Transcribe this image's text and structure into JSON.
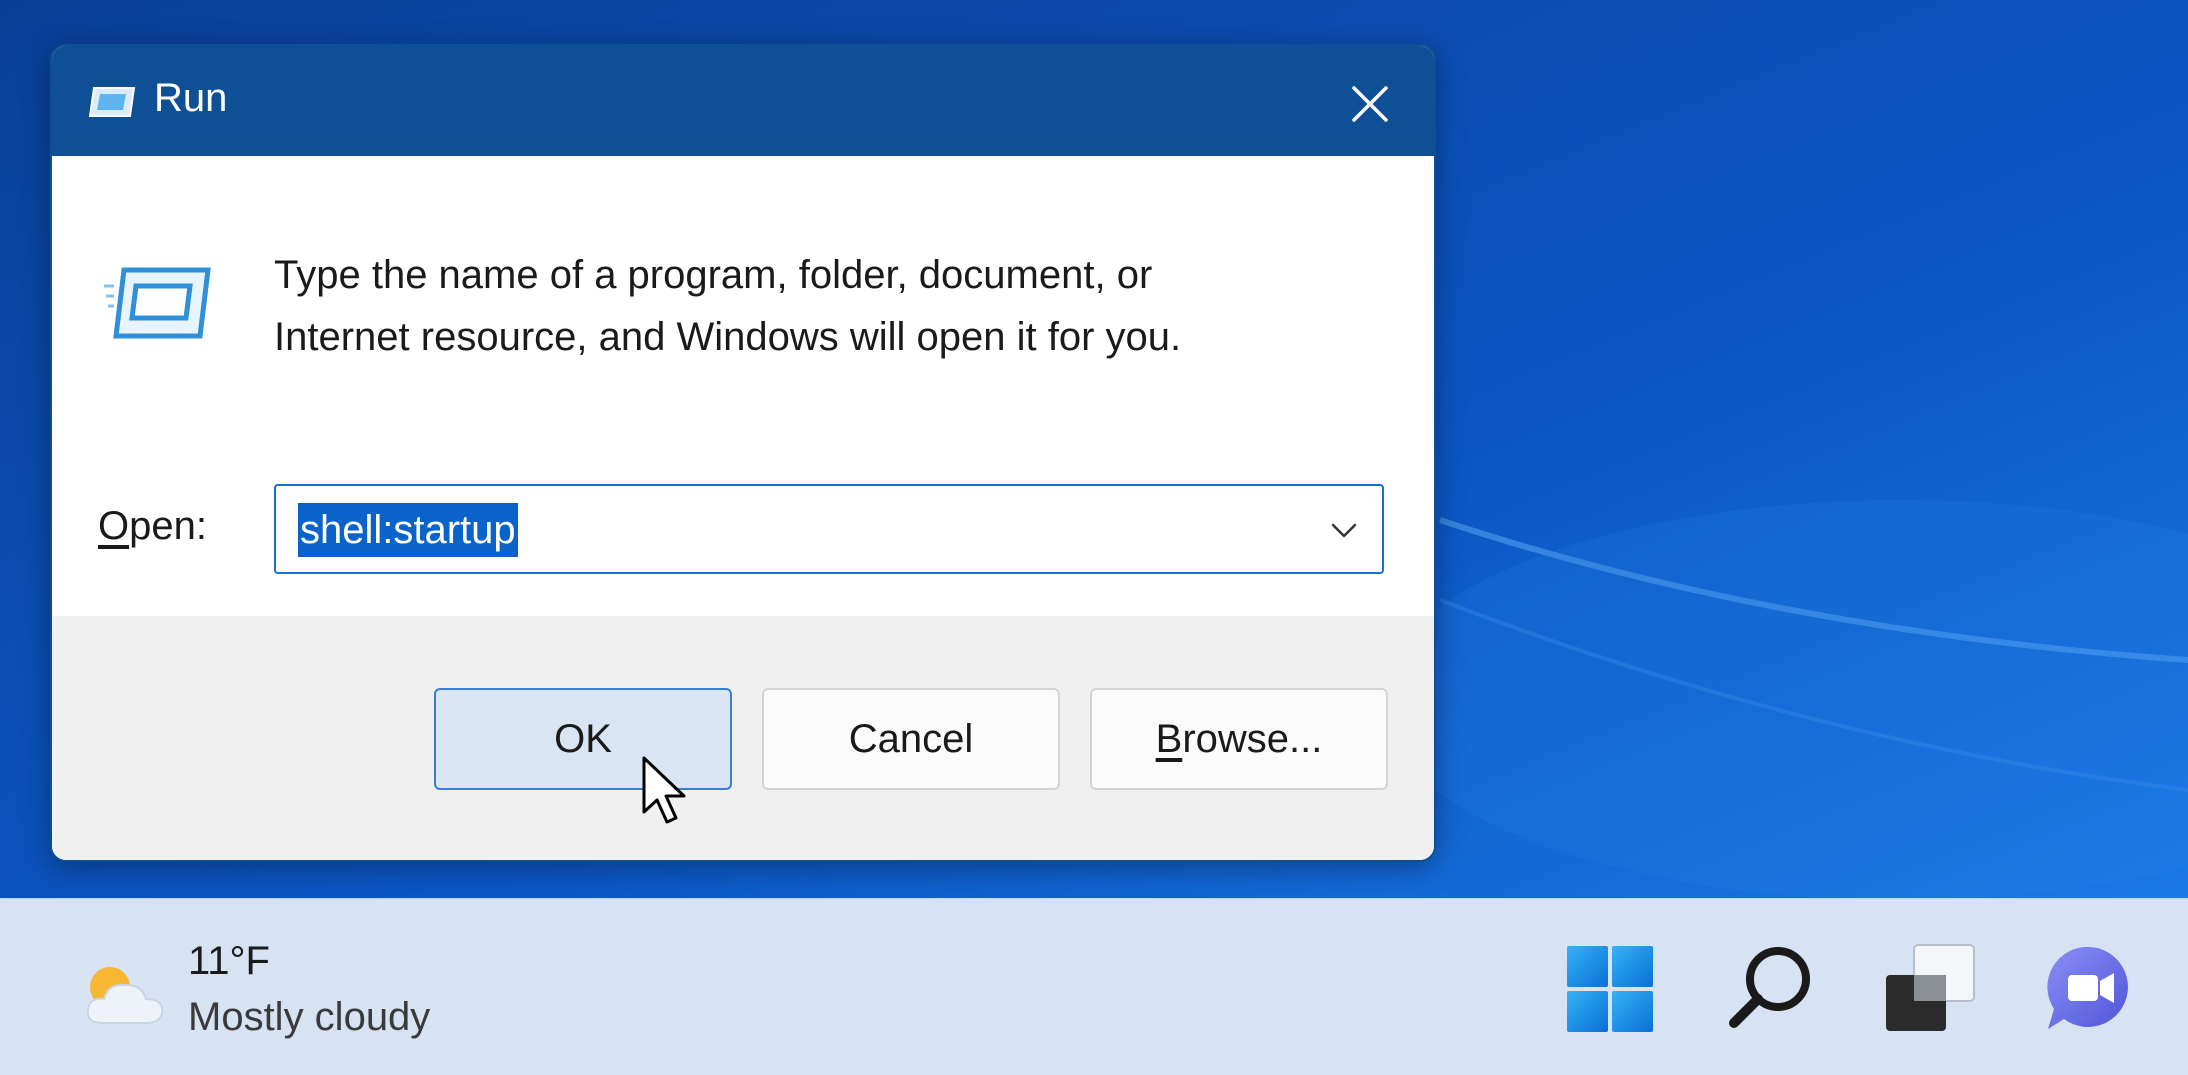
{
  "dialog": {
    "title": "Run",
    "description_line1": "Type the name of a program, folder, document, or",
    "description_line2": "Internet resource, and Windows will open it for you.",
    "open_label_underlined": "O",
    "open_label_rest": "pen:",
    "open_value": "shell:startup",
    "buttons": {
      "ok": "OK",
      "cancel": "Cancel",
      "browse_underlined": "B",
      "browse_rest": "rowse..."
    },
    "icons": {
      "title": "run-window-icon",
      "close": "close-icon",
      "dropdown": "chevron-down-icon"
    }
  },
  "taskbar": {
    "weather": {
      "temperature": "11°F",
      "condition": "Mostly cloudy",
      "icon": "partly-cloudy-icon"
    },
    "icons": [
      "windows-start-icon",
      "search-icon",
      "task-view-icon",
      "teams-chat-icon"
    ]
  },
  "colors": {
    "title_bar": "#0e4f95",
    "accent": "#0a63c9",
    "taskbar": "#d7e3f2"
  }
}
